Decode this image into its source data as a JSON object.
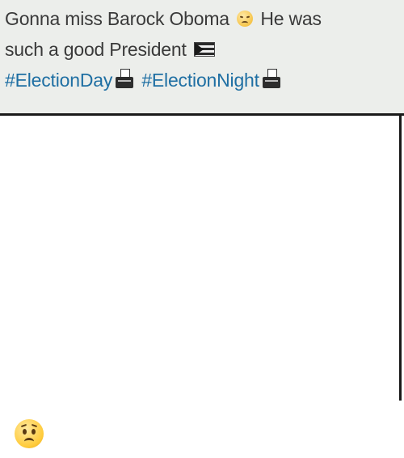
{
  "post": {
    "line1_a": "Gonna miss Barock Oboma",
    "line1_b": "He was",
    "line2": "such a good President",
    "hashtag1": "#ElectionDay",
    "hashtag2": "#ElectionNight"
  },
  "icons": {
    "after_line1": "disappointed-face-icon",
    "after_line2": "flag-icon",
    "after_hashtag1": "ballot-box-icon",
    "after_hashtag2": "ballot-box-icon",
    "reaction": "worried-face-icon"
  },
  "colors": {
    "header_bg": "#eceeeb",
    "text": "#3a3a3a",
    "hashtag": "#1f6fa3"
  }
}
